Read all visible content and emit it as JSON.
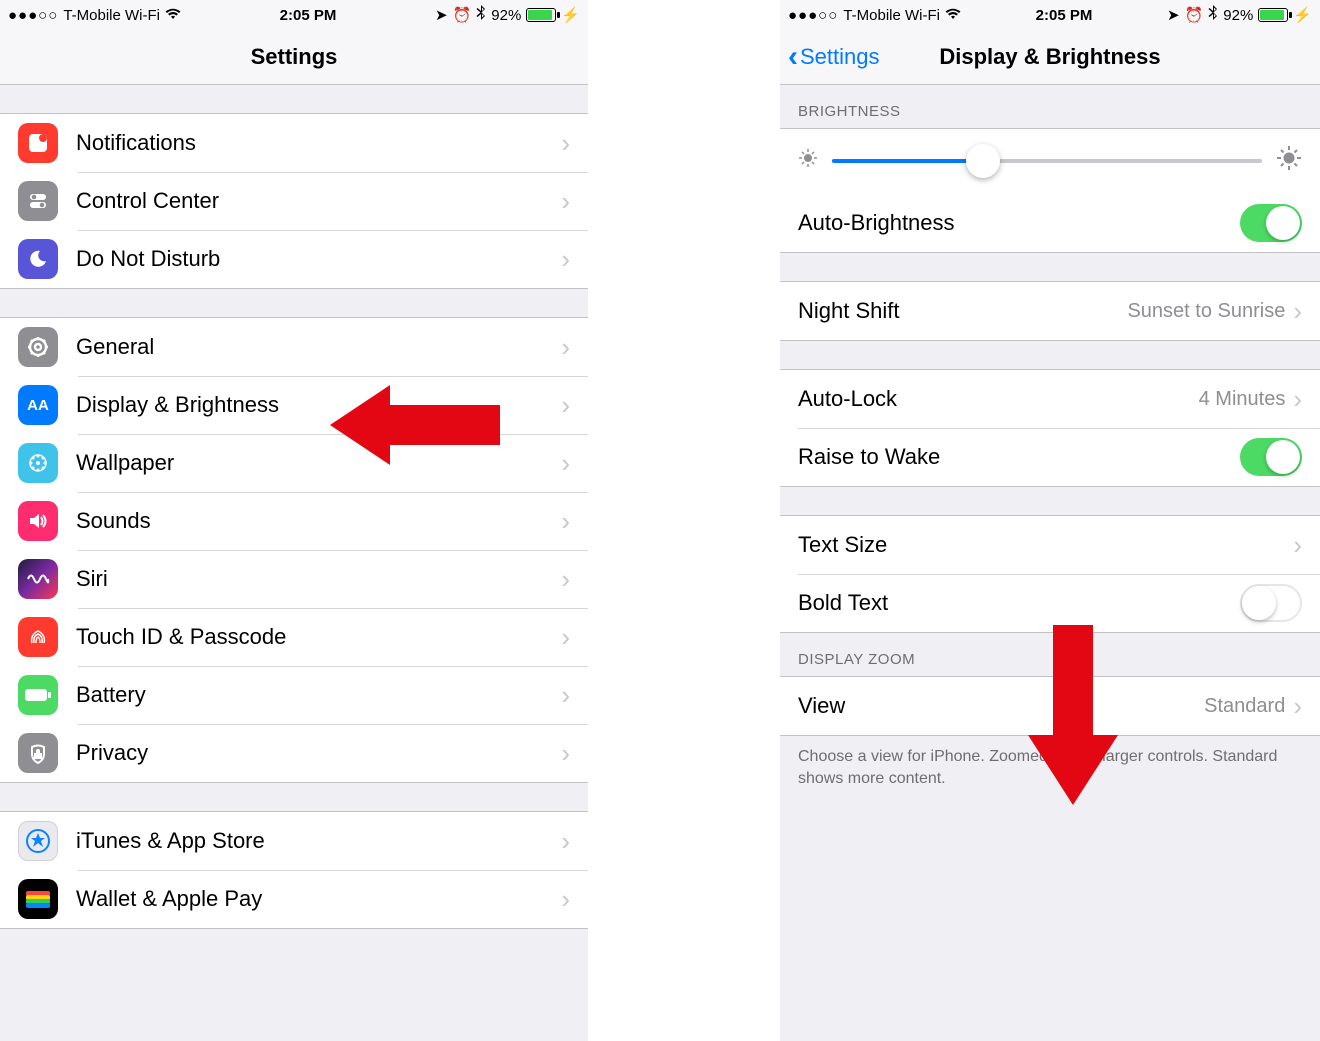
{
  "statusbar": {
    "carrier": "T-Mobile Wi-Fi",
    "time": "2:05 PM",
    "battery_pct": "92%"
  },
  "left": {
    "title": "Settings",
    "group1": [
      {
        "label": "Notifications",
        "icon": "notifications-icon"
      },
      {
        "label": "Control Center",
        "icon": "control-center-icon"
      },
      {
        "label": "Do Not Disturb",
        "icon": "do-not-disturb-icon"
      }
    ],
    "group2": [
      {
        "label": "General",
        "icon": "general-icon"
      },
      {
        "label": "Display & Brightness",
        "icon": "display-icon"
      },
      {
        "label": "Wallpaper",
        "icon": "wallpaper-icon"
      },
      {
        "label": "Sounds",
        "icon": "sounds-icon"
      },
      {
        "label": "Siri",
        "icon": "siri-icon"
      },
      {
        "label": "Touch ID & Passcode",
        "icon": "touchid-icon"
      },
      {
        "label": "Battery",
        "icon": "battery-icon"
      },
      {
        "label": "Privacy",
        "icon": "privacy-icon"
      }
    ],
    "group3": [
      {
        "label": "iTunes & App Store",
        "icon": "appstore-icon"
      },
      {
        "label": "Wallet & Apple Pay",
        "icon": "wallet-icon"
      }
    ]
  },
  "right": {
    "back": "Settings",
    "title": "Display & Brightness",
    "section_brightness": "BRIGHTNESS",
    "auto_brightness_label": "Auto-Brightness",
    "auto_brightness_on": true,
    "night_shift_label": "Night Shift",
    "night_shift_value": "Sunset to Sunrise",
    "auto_lock_label": "Auto-Lock",
    "auto_lock_value": "4 Minutes",
    "raise_to_wake_label": "Raise to Wake",
    "raise_to_wake_on": true,
    "text_size_label": "Text Size",
    "bold_text_label": "Bold Text",
    "bold_text_on": false,
    "section_zoom": "DISPLAY ZOOM",
    "view_label": "View",
    "view_value": "Standard",
    "zoom_footer": "Choose a view for iPhone. Zoomed shows larger controls. Standard shows more content.",
    "brightness_slider_pct": 35
  },
  "annotations": {
    "arrow_right": "red-arrow-right",
    "arrow_down": "red-arrow-down"
  }
}
